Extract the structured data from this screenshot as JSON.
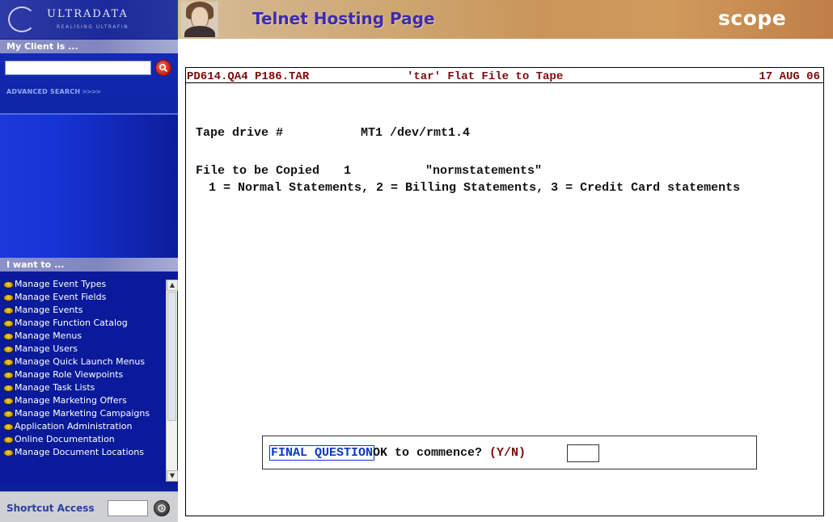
{
  "sidebar": {
    "logo_text": "ULTRADATA",
    "logo_tagline": "REALISING ULTRAFIN",
    "client_heading": "My Client is ...",
    "search_input_value": "",
    "advanced_search_label": "ADVANCED SEARCH",
    "advanced_search_arrows": ">>>>",
    "iwant_heading": "I want to ...",
    "menu_items": [
      "Manage Event Types",
      "Manage Event Fields",
      "Manage Events",
      "Manage Function Catalog",
      "Manage Menus",
      "Manage Users",
      "Manage Quick Launch Menus",
      "Manage Role Viewpoints",
      "Manage Task Lists",
      "Manage Marketing Offers",
      "Manage Marketing Campaigns",
      "Application Administration",
      "Online Documentation",
      "Manage Document Locations"
    ],
    "shortcut_label": "Shortcut Access",
    "shortcut_input_value": ""
  },
  "header": {
    "title": "Telnet Hosting Page",
    "brand": "scope"
  },
  "terminal": {
    "program": "PD614.QA4 P186.TAR",
    "screen_title": "'tar' Flat File to Tape",
    "date": "17 AUG 06",
    "tape_label": "Tape drive #",
    "tape_value": "MT1 /dev/rmt1.4",
    "file_label": "File to be Copied",
    "file_number": "1",
    "file_name": "\"normstatements\"",
    "file_options": "1 = Normal Statements, 2 = Billing Statements, 3 = Credit Card statements",
    "final_label": "FINAL QUESTION",
    "final_prompt": "OK to commence?",
    "final_yn": "(Y/N)",
    "final_input_value": ""
  },
  "colors": {
    "sidebar_bg": "#0b1f9e",
    "header_title": "#3c2bb0",
    "terminal_header_text": "#7d0b0b",
    "final_label": "#0a37c8"
  },
  "icons": {
    "search": "magnifier-icon",
    "shortcut_go": "go-icon",
    "menu_bullet": "gold-bullet-icon"
  }
}
